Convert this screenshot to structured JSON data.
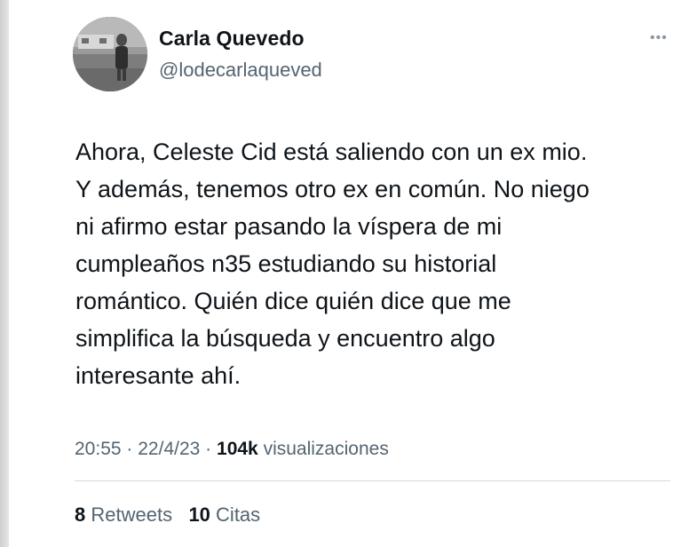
{
  "author": {
    "display_name": "Carla Quevedo",
    "handle": "@lodecarlaqueved",
    "avatar_icon": "profile-photo"
  },
  "more_icon": "ellipsis-icon",
  "more_glyph": "•••",
  "tweet": {
    "lines": [
      "Ahora, Celeste Cid está saliendo con un ex mio.",
      "Y además, tenemos otro ex en común. No niego",
      "ni afirmo estar pasando la víspera de mi",
      "cumpleaños n35 estudiando su historial",
      "romántico. Quién dice quién dice que me",
      "simplifica la búsqueda y encuentro algo",
      "interesante ahí."
    ]
  },
  "meta": {
    "time": "20:55",
    "separator": "·",
    "date": "22/4/23",
    "views_count": "104k",
    "views_label": "visualizaciones"
  },
  "stats": {
    "retweets_count": "8",
    "retweets_label": "Retweets",
    "quotes_count": "10",
    "quotes_label": "Citas"
  },
  "colors": {
    "text_primary": "#0f1419",
    "text_secondary": "#536471",
    "divider": "#d5dadd",
    "background": "#ffffff"
  }
}
